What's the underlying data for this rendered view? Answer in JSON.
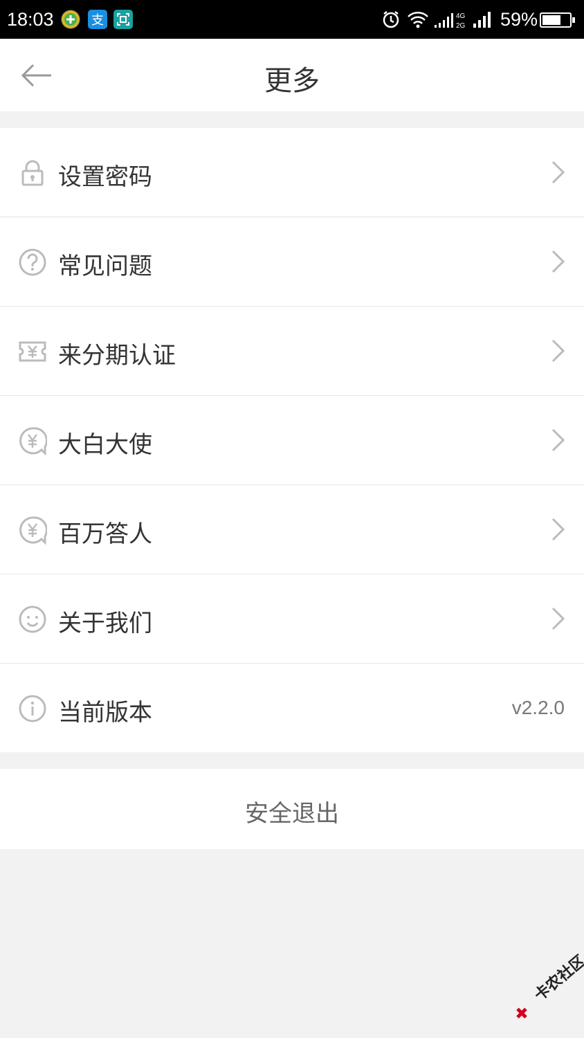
{
  "status_bar": {
    "time": "18:03",
    "battery": "59%",
    "notification_icons": [
      "app-plus-icon",
      "alipay-icon",
      "scan-icon"
    ],
    "system_icons": [
      "alarm-icon",
      "wifi-icon",
      "signal-4g-icon",
      "signal-icon",
      "battery-icon"
    ]
  },
  "header": {
    "title": "更多",
    "back_icon": "arrow-left-icon"
  },
  "menu": {
    "items": [
      {
        "label": "设置密码",
        "icon": "lock-icon"
      },
      {
        "label": "常见问题",
        "icon": "question-circle-icon"
      },
      {
        "label": "来分期认证",
        "icon": "yen-ticket-icon"
      },
      {
        "label": "大白大使",
        "icon": "yen-bubble-icon"
      },
      {
        "label": "百万答人",
        "icon": "yen-bubble-icon"
      },
      {
        "label": "关于我们",
        "icon": "smiley-icon"
      },
      {
        "label": "当前版本",
        "icon": "info-icon",
        "value": "v2.2.0"
      }
    ]
  },
  "logout": {
    "label": "安全退出"
  },
  "watermark": {
    "text": "卡农社区"
  },
  "colors": {
    "background": "#f2f2f2",
    "card": "#ffffff",
    "text_primary": "#333333",
    "icon_gray": "#bbbbbb",
    "divider": "#e5e5e5"
  }
}
